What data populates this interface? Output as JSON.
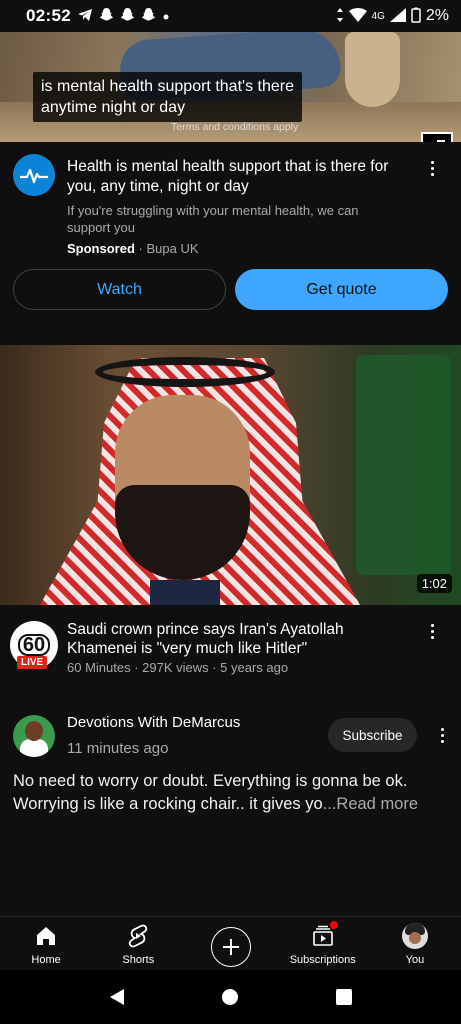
{
  "status_bar": {
    "time": "02:52",
    "network": "4G",
    "battery": "2%",
    "left_icons": [
      "telegram-icon",
      "snapchat-icon",
      "snapchat-icon",
      "snapchat-icon",
      "dot-icon"
    ],
    "right_icons": [
      "data-arrows-icon",
      "wifi-icon",
      "signal-icon",
      "battery-icon"
    ]
  },
  "ad": {
    "caption_line1": "is mental health support that's there",
    "caption_line2": "anytime night or day",
    "terms": "Terms and conditions apply",
    "title": "Health is mental health support that is there for you, any time, night or day",
    "description": "If you're struggling with your mental health, we can support you",
    "sponsored_label": "Sponsored",
    "separator": " · ",
    "advertiser": "Bupa UK",
    "watch_label": "Watch",
    "quote_label": "Get quote"
  },
  "video": {
    "duration": "1:02",
    "title": "Saudi crown prince says Iran's Ayatollah Khamenei is \"very much like Hitler\"",
    "meta": "60 Minutes · 297K views · 5 years ago",
    "channel_logo_text": "60",
    "live_label": "LIVE"
  },
  "post": {
    "channel": "Devotions With DeMarcus",
    "time": "11 minutes ago",
    "subscribe_label": "Subscribe",
    "text": "No need to worry or doubt. Everything is gonna be ok. Worrying is like a rocking chair.. it gives yo",
    "read_more": "...Read more"
  },
  "bottom_nav": {
    "items": [
      {
        "label": "Home",
        "icon": "home-icon"
      },
      {
        "label": "Shorts",
        "icon": "shorts-icon"
      },
      {
        "label": "",
        "icon": "create-icon"
      },
      {
        "label": "Subscriptions",
        "icon": "subscriptions-icon"
      },
      {
        "label": "You",
        "icon": "avatar"
      }
    ]
  },
  "colors": {
    "background": "#0f0f0f",
    "accent_blue": "#3ea6ff",
    "live_red": "#e62117",
    "secondary_text": "#aaaaaa"
  }
}
